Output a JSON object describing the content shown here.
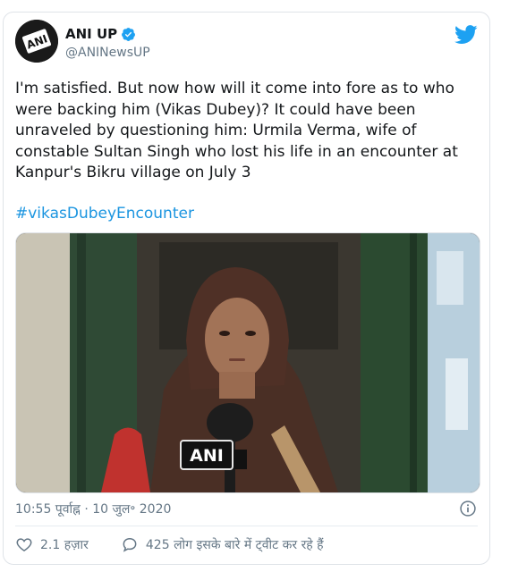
{
  "account": {
    "display_name": "ANI UP",
    "handle": "@ANINewsUP",
    "avatar_text": "ANI"
  },
  "tweet": {
    "text": "I'm satisfied. But now how will it come into fore as to who\nwere backing him (Vikas Dubey)? It could have been\nunraveled by questioning him: Urmila Verma, wife of\nconstable Sultan Singh who lost his life in an encounter at\nKanpur's Bikru village on July 3",
    "hashtag": "#vikasDubeyEncounter",
    "timestamp": "10:55 पूर्वाह्न · 10 जुल॰ 2020"
  },
  "media": {
    "mic_label": "ANI"
  },
  "actions": {
    "likes": "2.1 हज़ार",
    "conversation": "425 लोग इसके बारे में ट्वीट कर रहे हैं"
  },
  "colors": {
    "link": "#1b95e0",
    "secondary": "#657786",
    "twitter_blue": "#1da1f2",
    "border": "#dfe3e8"
  },
  "icons": [
    "twitter-bird-icon",
    "verified-badge-icon",
    "info-icon",
    "heart-icon",
    "comment-icon"
  ]
}
